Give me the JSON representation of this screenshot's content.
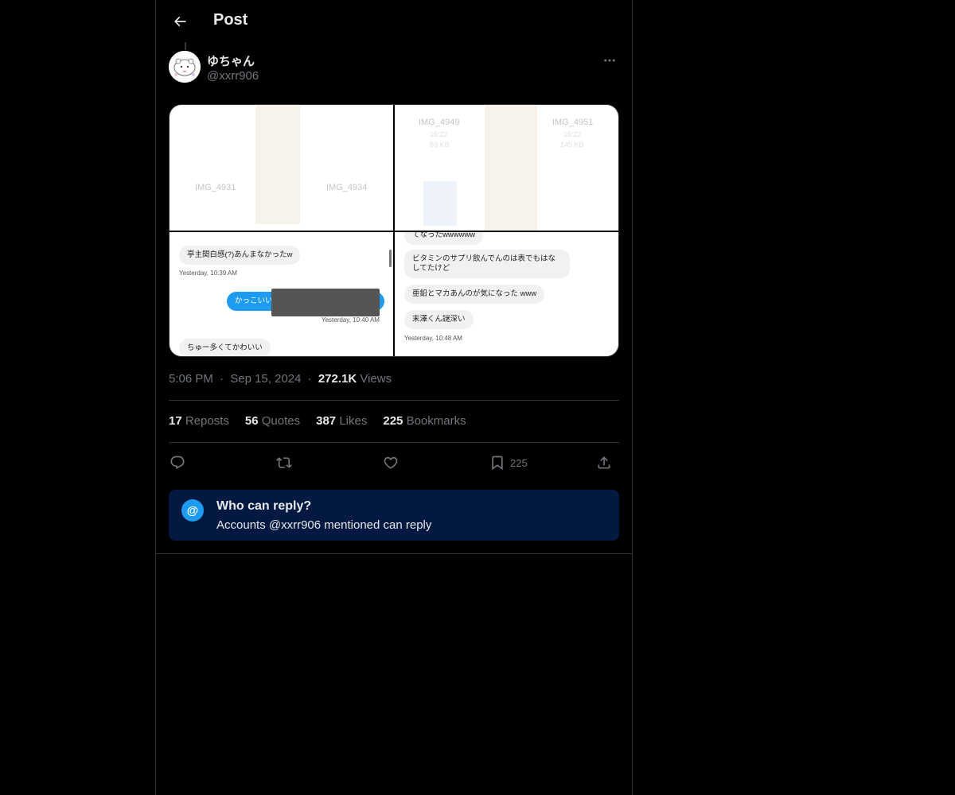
{
  "header": {
    "title": "Post",
    "back_icon": "arrow-left-icon"
  },
  "post": {
    "author": {
      "display_name": "ゆちゃん",
      "handle": "@xxrr906",
      "avatar_icon": "cartoon-avatar"
    },
    "more_icon": "more-dots-icon",
    "media": [
      {
        "labels": [
          "IMG_4931",
          "IMG_4934"
        ]
      },
      {
        "labels": [
          "IMG_4949",
          "IMG_4951"
        ],
        "subs": [
          "16:22",
          "89 KB",
          "16:22",
          "145 KB"
        ]
      },
      {
        "bubbles": [
          "亭主関白感(?)あんまなかったw",
          "かっこいい",
          "ちゅー多くてかわいい"
        ],
        "timestamps": [
          "Yesterday, 10:39 AM",
          "Yesterday, 10:40 AM"
        ]
      },
      {
        "bubbles": [
          "てなったwwwwww",
          "ビタミンのサプリ飲んでんのは表でもはなしてたけど",
          "亜鉛とマカあんのが気になった www",
          "末澤くん謎深い"
        ],
        "timestamps": [
          "Yesterday, 10:48 AM"
        ]
      }
    ],
    "time": "5:06 PM",
    "date": "Sep 15, 2024",
    "views_count": "272.1K",
    "views_label": "Views",
    "separator": "·"
  },
  "stats": {
    "reposts": {
      "count": "17",
      "label": "Reposts"
    },
    "quotes": {
      "count": "56",
      "label": "Quotes"
    },
    "likes": {
      "count": "387",
      "label": "Likes"
    },
    "bookmarks": {
      "count": "225",
      "label": "Bookmarks"
    }
  },
  "actions": {
    "reply_icon": "reply-icon",
    "repost_icon": "repost-icon",
    "like_icon": "heart-icon",
    "bookmark_icon": "bookmark-icon",
    "bookmark_count": "225",
    "share_icon": "share-icon"
  },
  "reply_restriction": {
    "icon": "at-icon",
    "title": "Who can reply?",
    "text_prefix": "Accounts",
    "mention": "@xxrr906",
    "text_suffix": "mentioned can reply"
  },
  "colors": {
    "accent": "#1d9bf0",
    "reply_box_bg": "#031941",
    "muted": "#71767b",
    "border": "#2f3336"
  }
}
